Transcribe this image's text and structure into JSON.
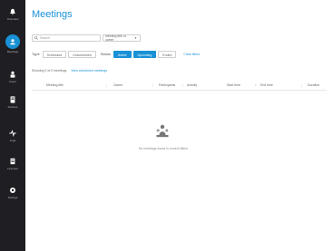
{
  "sidebar": {
    "items": [
      {
        "label": "Overview",
        "icon": "bell-icon"
      },
      {
        "label": "Meetings",
        "icon": "meetings-icon"
      },
      {
        "label": "Users",
        "icon": "user-icon"
      },
      {
        "label": "Devices",
        "icon": "device-icon"
      },
      {
        "label": "Logs",
        "icon": "activity-icon"
      },
      {
        "label": "Licenses",
        "icon": "license-icon"
      },
      {
        "label": "Settings",
        "icon": "gear-icon"
      }
    ]
  },
  "page": {
    "title": "Meetings"
  },
  "search": {
    "placeholder": "Search"
  },
  "select": {
    "label": "meeting title or owner"
  },
  "filters": {
    "type_label": "Type",
    "type_options": [
      "Scheduled",
      "Unscheduled"
    ],
    "status_label": "Status",
    "status_options": [
      "Active",
      "Upcoming",
      "Ended"
    ],
    "clear_label": "Clear filters"
  },
  "results": {
    "showing": "Showing 0 of 0 meetings",
    "link": "View scheduled meetings"
  },
  "table": {
    "columns": [
      "Meeting title",
      "Owner",
      "Participants",
      "Activity",
      "Start time",
      "End time",
      "Duration"
    ]
  },
  "empty": {
    "message": "No meetings found in current filters"
  },
  "colors": {
    "accent": "#1991d6",
    "sidebar": "#1f1f23"
  }
}
